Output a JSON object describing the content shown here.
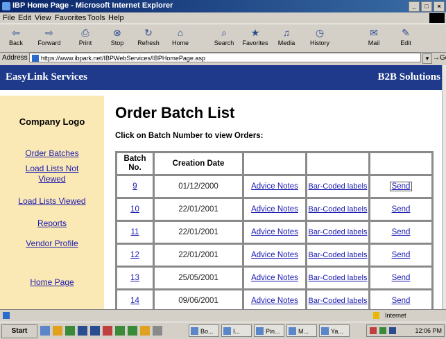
{
  "window": {
    "title": "IBP Home Page - Microsoft Internet Explorer",
    "controls": [
      "_",
      "□",
      "×"
    ]
  },
  "menu": [
    "File",
    "Edit",
    "View",
    "Favorites",
    "Tools",
    "Help"
  ],
  "toolbar": [
    {
      "label": "Back",
      "icon": "back-arrow-icon"
    },
    {
      "label": "Forward",
      "icon": "forward-arrow-icon"
    },
    {
      "label": "Print",
      "icon": "print-icon"
    },
    {
      "label": "Stop",
      "icon": "stop-icon"
    },
    {
      "label": "Refresh",
      "icon": "refresh-icon"
    },
    {
      "label": "Home",
      "icon": "home-icon"
    },
    {
      "label": "Search",
      "icon": "search-icon"
    },
    {
      "label": "Favorites",
      "icon": "favorites-icon"
    },
    {
      "label": "Media",
      "icon": "media-icon"
    },
    {
      "label": "History",
      "icon": "history-icon"
    },
    {
      "label": "Mail",
      "icon": "mail-icon"
    },
    {
      "label": "Edit",
      "icon": "edit-icon"
    }
  ],
  "address": {
    "label": "Address",
    "url": "https://www.ibpark.net/IBPWebServices/IBPHomePage.asp",
    "go": "Go"
  },
  "banner": {
    "left": "EasyLink Services",
    "right": "B2B Solutions"
  },
  "sidebar": {
    "logo": "Company Logo",
    "links": [
      "Order Batches",
      "Load Lists Not Viewed",
      "Load Lists Viewed",
      "Reports",
      "Vendor Profile",
      "Home Page"
    ]
  },
  "main": {
    "title": "Order Batch List",
    "instruction": "Click on Batch Number to view Orders:",
    "headers": [
      "Batch No.",
      "Creation Date",
      "",
      "",
      ""
    ],
    "rows": [
      {
        "batch": "9",
        "date": "01/12/2000",
        "advice": "Advice Notes",
        "barcode": "Bar-Coded labels",
        "send": "Send"
      },
      {
        "batch": "10",
        "date": "22/01/2001",
        "advice": "Advice Notes",
        "barcode": "Bar-Coded labels",
        "send": "Send"
      },
      {
        "batch": "11",
        "date": "22/01/2001",
        "advice": "Advice Notes",
        "barcode": "Bar-Coded labels",
        "send": "Send"
      },
      {
        "batch": "12",
        "date": "22/01/2001",
        "advice": "Advice Notes",
        "barcode": "Bar-Coded labels",
        "send": "Send"
      },
      {
        "batch": "13",
        "date": "25/05/2001",
        "advice": "Advice Notes",
        "barcode": "Bar-Coded labels",
        "send": "Send"
      },
      {
        "batch": "14",
        "date": "09/06/2001",
        "advice": "Advice Notes",
        "barcode": "Bar-Coded labels",
        "send": "Send"
      }
    ]
  },
  "statusbar": {
    "zone": "Internet"
  },
  "taskbar": {
    "start": "Start",
    "tasks": [
      "Bo...",
      "I...",
      "Pin...",
      "M...",
      "Ya...",
      "Mi..."
    ],
    "clock": "12:06 PM"
  },
  "colors": {
    "banner": "#1f3a8a",
    "sidebar": "#fbe9b5",
    "link": "#1a1ab0",
    "titlebar": "#0a246a"
  }
}
